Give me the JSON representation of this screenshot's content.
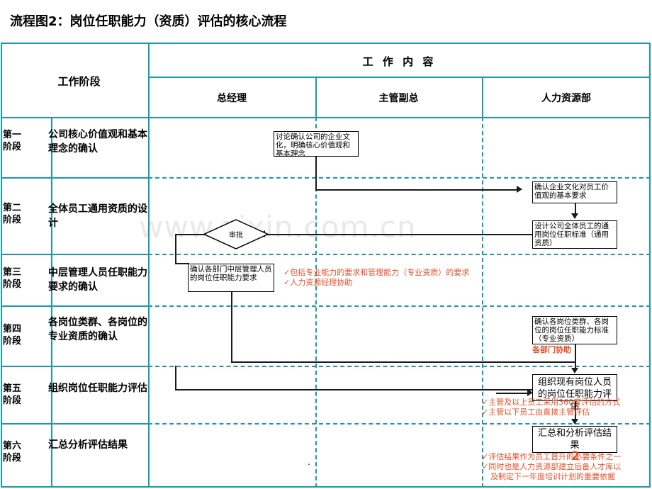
{
  "title": "流程图2：岗位任职能力（资质）评估的核心流程",
  "watermark": "www.zixin.com.cn",
  "page_number": "2",
  "dot_marker": ".",
  "colors": {
    "grid": "#1b9aaa",
    "box_border": "#000000",
    "note_red": "#e8502a",
    "text": "#000000"
  },
  "header": {
    "stage_col": "工作阶段",
    "work_col": "工 作 内 容",
    "lanes": [
      {
        "label": "总经理"
      },
      {
        "label": "主管副总"
      },
      {
        "label": "人力资源部"
      }
    ]
  },
  "stages": [
    {
      "no": "第一\n阶段",
      "no_line1": "第一",
      "no_line2": "阶段",
      "name": "公司核心价值观和基本理念的确认"
    },
    {
      "no_line1": "第二",
      "no_line2": "阶段",
      "name": "全体员工通用资质的设计"
    },
    {
      "no_line1": "第三",
      "no_line2": "阶段",
      "name": "中层管理人员任职能力要求的确认"
    },
    {
      "no_line1": "第四",
      "no_line2": "阶段",
      "name": "各岗位类群、各岗位的专业资质的确认"
    },
    {
      "no_line1": "第五",
      "no_line2": "阶段",
      "name": "组织岗位任职能力评估"
    },
    {
      "no_line1": "第六",
      "no_line2": "阶段",
      "name": "汇总分析评估结果"
    }
  ],
  "nodes": {
    "discuss_culture": "讨论确认公司的企业文化，明确核心价值观和基本理念",
    "confirm_culture_req": "确认企业文化对员工价值观的基本要求",
    "design_general_std": "设计公司全体员工的通用岗位任职标准（通用资质）",
    "approval": "审批",
    "confirm_middle_mgr": "确认各部门中层管理人员的岗位任职能力要求",
    "confirm_job_family_std": "确认各岗位类群、各岗位的岗位任职能力标准（专业资质）",
    "organize_assessment": "组织现有岗位人员的岗位任职能力评估",
    "summarize_results": "汇总和分析评估结果"
  },
  "notes": {
    "stage3": [
      "✓包括专业能力的要求和管理能力（专业资质）的要求",
      "✓人力资源经理协助"
    ],
    "stage4": [
      "各部门协助"
    ],
    "stage5": [
      "✓主管及以上员工采用360度评估的方式",
      "✓主管以下员工由直接主管评估"
    ],
    "stage6": [
      "✓评估结果作为员工晋升的必要条件之一",
      "✓同时也是人力资源部建立后备人才库以",
      "及制定下一年度培训计划的重要依据"
    ]
  }
}
